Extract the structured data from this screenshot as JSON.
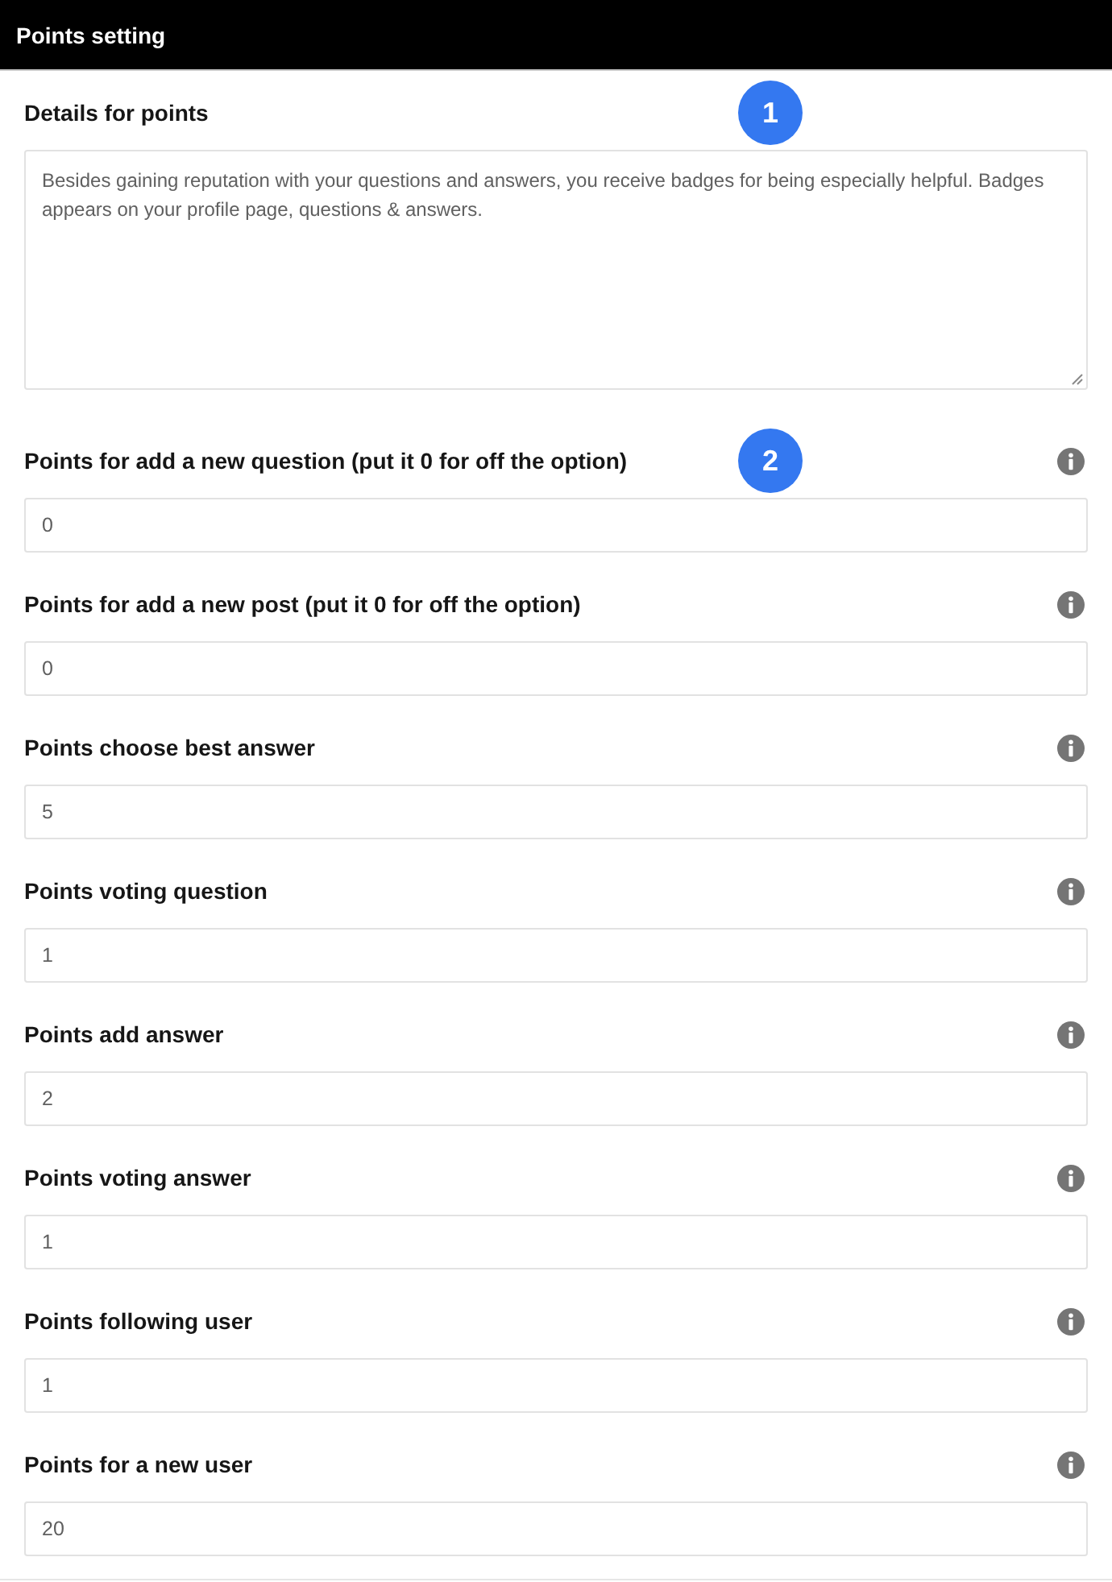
{
  "header": {
    "title": "Points setting"
  },
  "details": {
    "label": "Details for points",
    "marker": "1",
    "value": "Besides gaining reputation with your questions and answers, you receive badges for being especially helpful. Badges appears on your profile page, questions & answers."
  },
  "fields": [
    {
      "label": "Points for add a new question (put it 0 for off the option)",
      "value": "0",
      "marker": "2"
    },
    {
      "label": "Points for add a new post (put it 0 for off the option)",
      "value": "0"
    },
    {
      "label": "Points choose best answer",
      "value": "5"
    },
    {
      "label": "Points voting question",
      "value": "1"
    },
    {
      "label": "Points add answer",
      "value": "2"
    },
    {
      "label": "Points voting answer",
      "value": "1"
    },
    {
      "label": "Points following user",
      "value": "1"
    },
    {
      "label": "Points for a new user",
      "value": "20"
    }
  ]
}
